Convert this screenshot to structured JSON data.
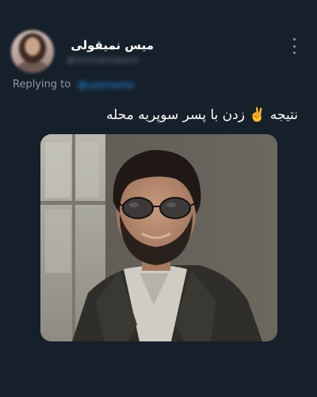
{
  "tweet": {
    "author": {
      "display_name": "میس نمیقولی",
      "handle": "@misnamiqooli"
    },
    "replying": {
      "label": "Replying to",
      "handle": "@username"
    },
    "text": "نتیجه ✌️ زدن با پسر سوپریه محله",
    "media": {
      "alt": "Photo of a bearded man wearing aviator sunglasses and a dark jacket, smiling"
    }
  },
  "icons": {
    "more": "more-vertical-icon"
  },
  "colors": {
    "background": "#16202b",
    "text_primary": "#ffffff",
    "text_secondary": "#8b98a5",
    "accent": "#1d9bf0"
  }
}
